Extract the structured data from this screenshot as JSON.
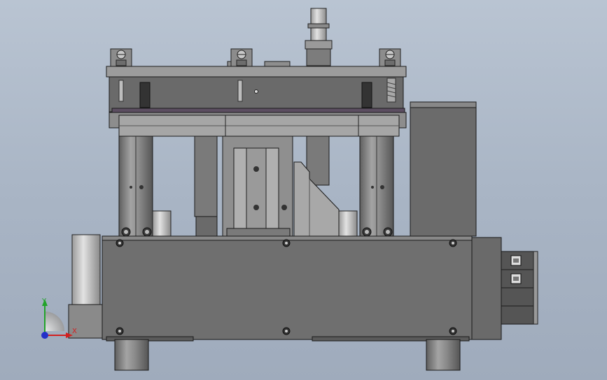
{
  "triad": {
    "x_label": "X",
    "y_label": "Y",
    "x_color": "#d22020",
    "y_color": "#22a32a",
    "z_color": "#2430c8"
  },
  "colors": {
    "background": "#a9b5c5",
    "metal_dark": "#6b6b6b",
    "metal_mid": "#8c8c8c",
    "metal_light": "#bdbdbd",
    "outline": "#1a1a1a"
  }
}
